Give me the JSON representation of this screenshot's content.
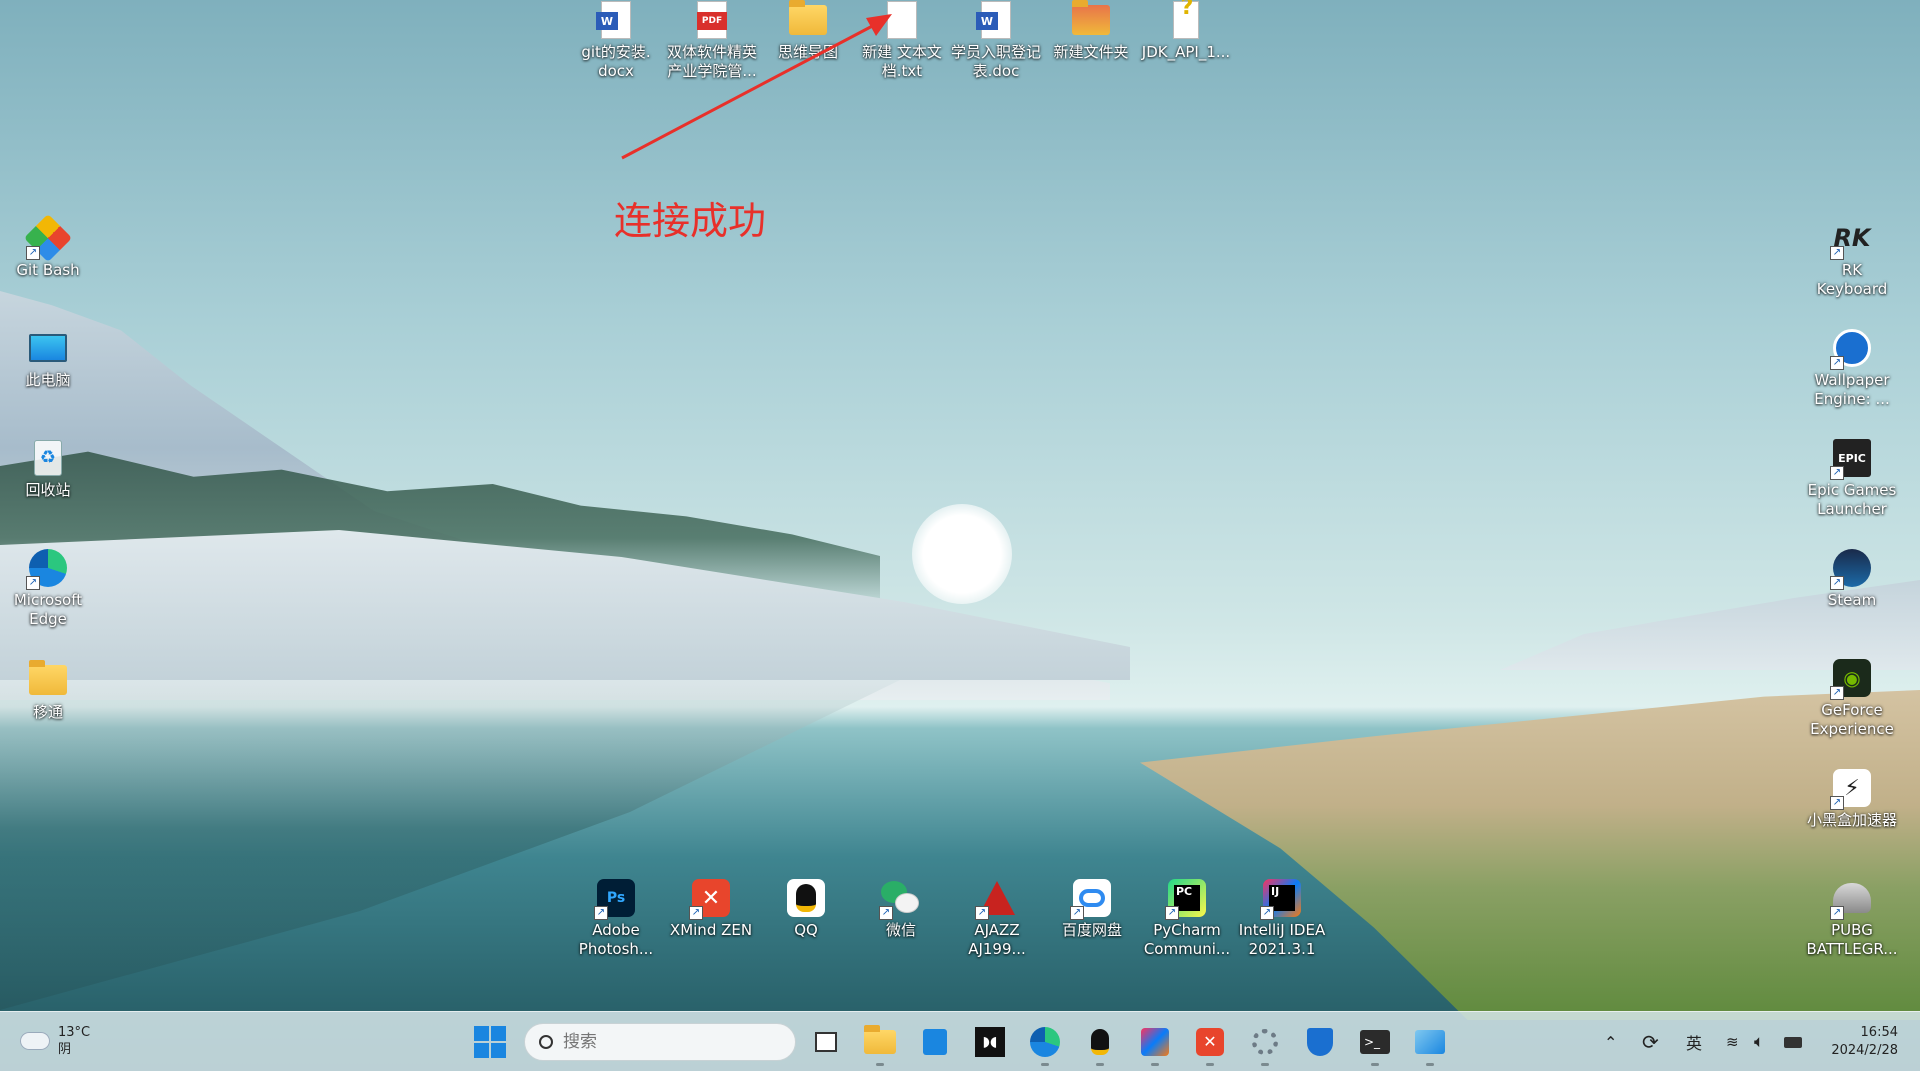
{
  "annotation": {
    "text": "连接成功"
  },
  "desktop_top": [
    {
      "label": "git的安装.\ndocx",
      "icon": "word-doc-icon"
    },
    {
      "label": "双体软件精英\n产业学院管...",
      "icon": "pdf-icon"
    },
    {
      "label": "思维导图",
      "icon": "folder-icon"
    },
    {
      "label": "新建 文本文\n档.txt",
      "icon": "text-file-icon"
    },
    {
      "label": "学员入职登记\n表.doc",
      "icon": "word-doc-icon"
    },
    {
      "label": "新建文件夹",
      "icon": "folder-icon"
    },
    {
      "label": "JDK_API_1...",
      "icon": "help-file-icon"
    }
  ],
  "desktop_left": [
    {
      "label": "Git Bash",
      "icon": "git-bash-icon"
    },
    {
      "label": "此电脑",
      "icon": "computer-icon"
    },
    {
      "label": "回收站",
      "icon": "recycle-bin-icon"
    },
    {
      "label": "Microsoft\nEdge",
      "icon": "edge-icon"
    },
    {
      "label": "移通",
      "icon": "folder-icon"
    }
  ],
  "desktop_right": [
    {
      "label": "RK\nKeyboard",
      "icon": "rk-keyboard-icon"
    },
    {
      "label": "Wallpaper\nEngine: ...",
      "icon": "wallpaper-engine-icon"
    },
    {
      "label": "Epic Games\nLauncher",
      "icon": "epic-games-icon"
    },
    {
      "label": "Steam",
      "icon": "steam-icon"
    },
    {
      "label": "GeForce\nExperience",
      "icon": "geforce-icon"
    },
    {
      "label": "小黑盒加速器",
      "icon": "xiaoheihe-icon"
    },
    {
      "label": "PUBG\nBATTLEGR...",
      "icon": "pubg-icon"
    }
  ],
  "desktop_bottom": [
    {
      "label": "Adobe\nPhotosh...",
      "icon": "photoshop-icon"
    },
    {
      "label": "XMind ZEN",
      "icon": "xmind-icon"
    },
    {
      "label": "QQ",
      "icon": "qq-icon"
    },
    {
      "label": "微信",
      "icon": "wechat-icon"
    },
    {
      "label": "AJAZZ\nAJ199...",
      "icon": "ajazz-icon"
    },
    {
      "label": "百度网盘",
      "icon": "baidu-netdisk-icon"
    },
    {
      "label": "PyCharm\nCommuni...",
      "icon": "pycharm-icon"
    },
    {
      "label": "IntelliJ IDEA\n2021.3.1",
      "icon": "intellij-icon"
    }
  ],
  "taskbar": {
    "weather_temp": "13°C",
    "weather_desc": "阴",
    "search_placeholder": "搜索",
    "ime": "英",
    "time": "16:54",
    "date": "2024/2/28"
  },
  "colors": {
    "annotation": "#e8302a",
    "accent": "#1a86e0"
  }
}
